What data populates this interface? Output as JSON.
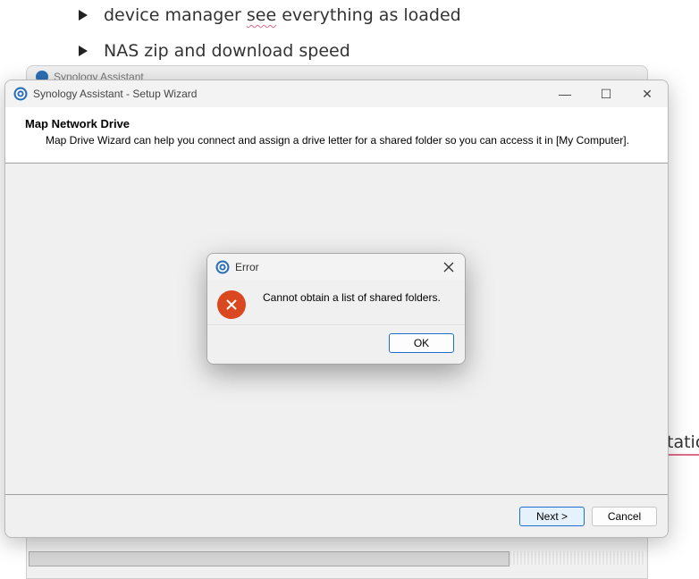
{
  "document": {
    "bullets": [
      "device manager see everything as loaded",
      "NAS zip and download speed"
    ],
    "bullet1_pre": "device manager ",
    "bullet1_squiggle": "see",
    "bullet1_post": " everything as loaded",
    "right_fragment": "tatic"
  },
  "back_window": {
    "title": "Synology Assistant"
  },
  "wizard": {
    "title": "Synology Assistant - Setup Wizard",
    "header_title": "Map Network Drive",
    "header_description": "Map Drive Wizard can help you connect and assign a drive letter for a shared folder so you can access it in [My Computer].",
    "next_label": "Next >",
    "cancel_label": "Cancel",
    "controls": {
      "minimize": "—",
      "maximize": "☐",
      "close": "✕"
    }
  },
  "error_dialog": {
    "title": "Error",
    "message": "Cannot obtain a list of shared folders.",
    "ok_label": "OK",
    "icon": "error-icon"
  },
  "colors": {
    "accent": "#1c6fd0",
    "error_red": "#d9481f",
    "app_icon_blue": "#2a6fb5"
  }
}
